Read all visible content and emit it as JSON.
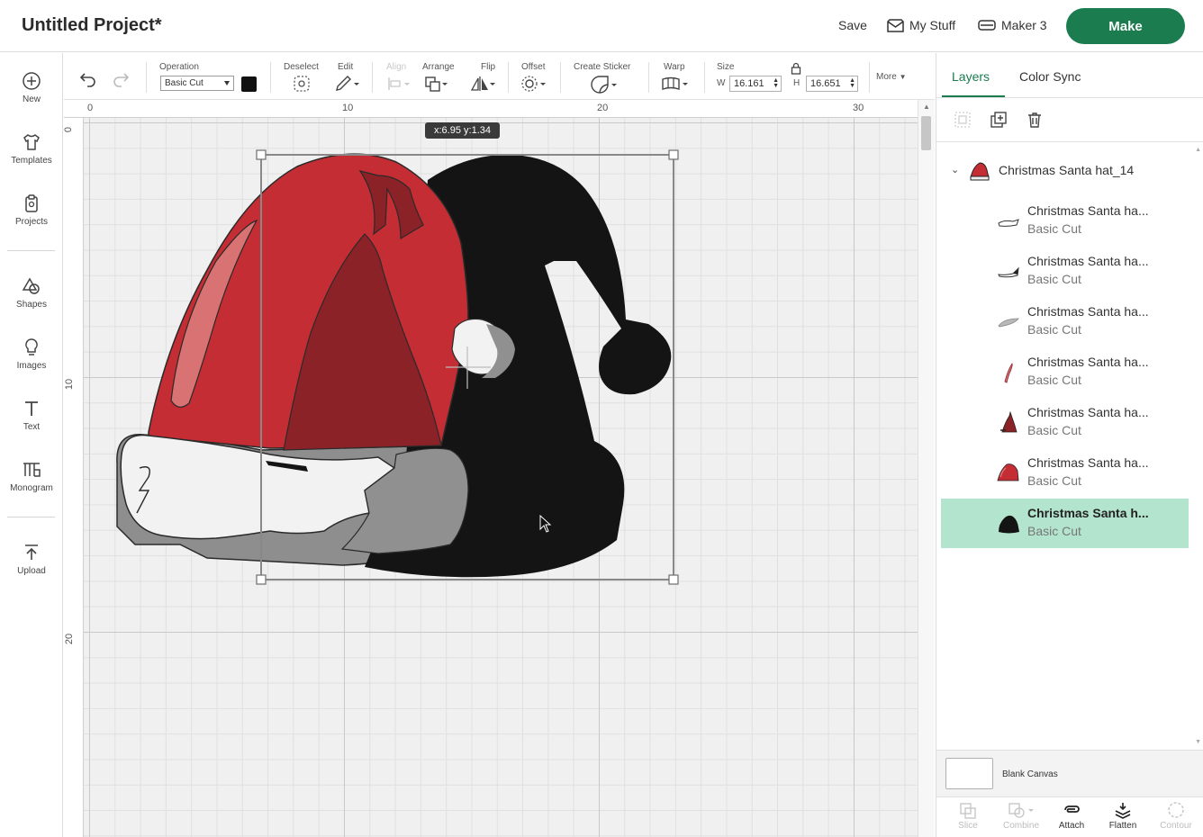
{
  "header": {
    "title": "Untitled Project*",
    "save_label": "Save",
    "my_stuff_label": "My Stuff",
    "machine_label": "Maker 3",
    "make_label": "Make",
    "accent_color": "#1b7c4f"
  },
  "sidebar": {
    "items": [
      {
        "label": "New",
        "icon": "plus-circle-icon"
      },
      {
        "label": "Templates",
        "icon": "shirt-icon"
      },
      {
        "label": "Projects",
        "icon": "clipboard-icon"
      },
      {
        "label": "Shapes",
        "icon": "shapes-icon"
      },
      {
        "label": "Images",
        "icon": "lightbulb-icon"
      },
      {
        "label": "Text",
        "icon": "text-icon"
      },
      {
        "label": "Monogram",
        "icon": "monogram-icon"
      },
      {
        "label": "Upload",
        "icon": "upload-icon"
      }
    ]
  },
  "toolbar": {
    "operation_label": "Operation",
    "operation_value": "Basic Cut",
    "swatch_color": "#111111",
    "deselect_label": "Deselect",
    "edit_label": "Edit",
    "align_label": "Align",
    "arrange_label": "Arrange",
    "flip_label": "Flip",
    "offset_label": "Offset",
    "create_sticker_label": "Create Sticker",
    "warp_label": "Warp",
    "size_label": "Size",
    "width_letter": "W",
    "width_value": "16.161",
    "height_letter": "H",
    "height_value": "16.651",
    "more_label": "More"
  },
  "canvas": {
    "ruler_top": [
      "0",
      "10",
      "20",
      "30"
    ],
    "ruler_left": [
      "0",
      "10",
      "20"
    ],
    "coords_tooltip": "x:6.95 y:1.34"
  },
  "panel": {
    "tabs": [
      "Layers",
      "Color Sync"
    ],
    "group_name": "Christmas Santa hat_14",
    "layers": [
      {
        "name": "Christmas Santa ha...",
        "operation": "Basic Cut",
        "thumb": "trim-outline"
      },
      {
        "name": "Christmas Santa ha...",
        "operation": "Basic Cut",
        "thumb": "trim-black"
      },
      {
        "name": "Christmas Santa ha...",
        "operation": "Basic Cut",
        "thumb": "grey-fur"
      },
      {
        "name": "Christmas Santa ha...",
        "operation": "Basic Cut",
        "thumb": "pink-highlight"
      },
      {
        "name": "Christmas Santa ha...",
        "operation": "Basic Cut",
        "thumb": "dark-red-fold"
      },
      {
        "name": "Christmas Santa ha...",
        "operation": "Basic Cut",
        "thumb": "red-hat"
      },
      {
        "name": "Christmas Santa h...",
        "operation": "Basic Cut",
        "thumb": "black-hat"
      }
    ],
    "blank_canvas_label": "Blank Canvas",
    "bottom_tools": [
      {
        "label": "Slice",
        "enabled": false
      },
      {
        "label": "Combine",
        "enabled": false
      },
      {
        "label": "Attach",
        "enabled": true
      },
      {
        "label": "Flatten",
        "enabled": true
      },
      {
        "label": "Contour",
        "enabled": false
      }
    ]
  }
}
